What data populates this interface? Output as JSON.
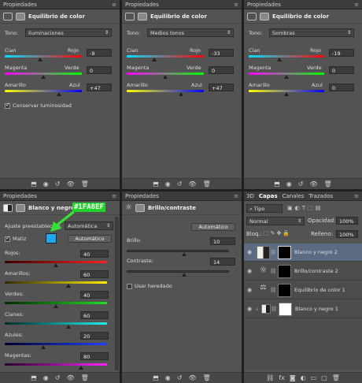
{
  "panel_tab": "Propiedades",
  "color_balance_title": "Equilibrio de color",
  "tone_label": "Tono:",
  "tones": [
    "Iluminaciones",
    "Medios tonos",
    "Sombras"
  ],
  "cb_labels": {
    "cian": "Cian",
    "rojo": "Rojo",
    "magenta": "Magenta",
    "verde": "Verde",
    "amarillo": "Amarillo",
    "azul": "Azul",
    "preserve": "Conservar luminosidad"
  },
  "cb_values": [
    [
      "-9",
      "0",
      "+47"
    ],
    [
      "-33",
      "0",
      "+47"
    ],
    [
      "-19",
      "0",
      "0"
    ]
  ],
  "bw": {
    "title": "Blanco y negro",
    "preset_label": "Ajuste preestablecido:",
    "preset_value": "Automática",
    "tint_label": "Matiz",
    "tint_color": "#1FA8EF",
    "callout": "#1FA8EF",
    "auto_button": "Automático",
    "sliders": [
      {
        "label": "Rojos:",
        "value": "40"
      },
      {
        "label": "Amarillos:",
        "value": "60"
      },
      {
        "label": "Verdes:",
        "value": "40"
      },
      {
        "label": "Cianes:",
        "value": "60"
      },
      {
        "label": "Azules:",
        "value": "20"
      },
      {
        "label": "Magentas:",
        "value": "80"
      }
    ]
  },
  "bc": {
    "title": "Brillo/contraste",
    "auto_button": "Automático",
    "brightness_label": "Brillo:",
    "brightness_value": "10",
    "contrast_label": "Contraste:",
    "contrast_value": "14",
    "legacy_label": "Usar heredado"
  },
  "layers_panel": {
    "tabs": [
      "3D",
      "Capas",
      "Canales",
      "Trazados"
    ],
    "kind_filter": "Tipo",
    "blend_mode": "Normal",
    "opacity_label": "Opacidad:",
    "opacity_value": "100%",
    "lock_label": "Bloq.:",
    "fill_label": "Relleno:",
    "fill_value": "100%",
    "layers": [
      "Blanco y negro 2",
      "Brillo/contraste 2",
      "Equilibrio de color 1",
      "Blanco y negro 1"
    ]
  },
  "footer_icons": [
    "clip-icon",
    "view-icon",
    "reset-icon",
    "visibility-icon",
    "trash-icon"
  ]
}
